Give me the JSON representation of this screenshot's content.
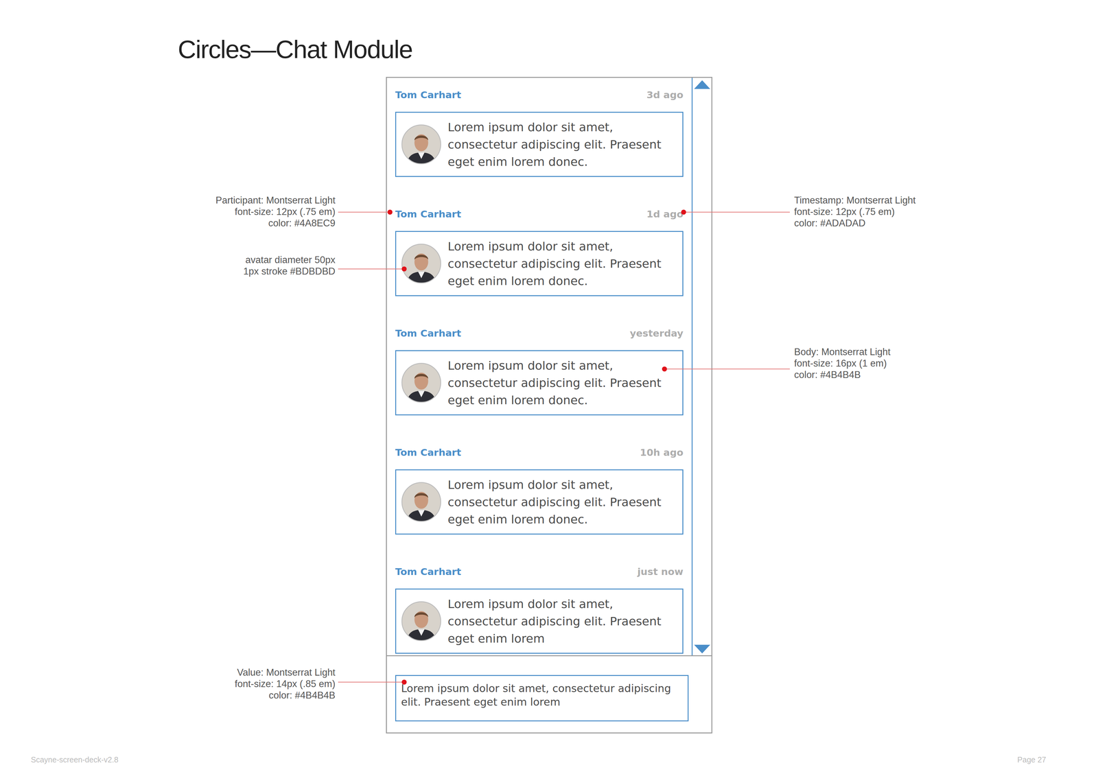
{
  "page": {
    "title": "Circles—Chat Module",
    "footer_left": "Scayne-screen-deck-v2.8",
    "footer_right": "Page 27"
  },
  "messages": [
    {
      "participant": "Tom Carhart",
      "timestamp": "3d ago",
      "body": "Lorem ipsum dolor sit amet, consectetur adipiscing elit. Praesent eget enim lorem donec."
    },
    {
      "participant": "Tom Carhart",
      "timestamp": "1d ago",
      "body": "Lorem ipsum dolor sit amet, consectetur adipiscing elit. Praesent eget enim lorem donec."
    },
    {
      "participant": "Tom Carhart",
      "timestamp": "yesterday",
      "body": "Lorem ipsum dolor sit amet, consectetur adipiscing elit. Praesent eget enim lorem donec."
    },
    {
      "participant": "Tom Carhart",
      "timestamp": "10h ago",
      "body": "Lorem ipsum dolor sit amet, consectetur adipiscing elit. Praesent eget enim lorem donec."
    },
    {
      "participant": "Tom Carhart",
      "timestamp": "just now",
      "body": "Lorem ipsum dolor sit amet, consectetur adipiscing elit. Praesent eget enim lorem"
    }
  ],
  "input": {
    "value": "Lorem ipsum dolor sit amet, consectetur adipiscing elit. Praesent eget enim lorem"
  },
  "annotations": [
    {
      "lines": [
        "Participant: Montserrat Light",
        "font-size: 12px (.75 em)",
        "color: #4A8EC9"
      ]
    },
    {
      "lines": [
        "avatar diameter 50px",
        "1px stroke #BDBDBD"
      ]
    },
    {
      "lines": [
        "Value: Montserrat Light",
        "font-size: 14px (.85 em)",
        "color: #4B4B4B"
      ]
    },
    {
      "lines": [
        "Timestamp: Montserrat Light",
        "font-size: 12px (.75 em)",
        "color: #ADADAD"
      ]
    },
    {
      "lines": [
        "Body: Montserrat Light",
        "font-size: 16px (1 em)",
        "color: #4B4B4B"
      ]
    }
  ]
}
